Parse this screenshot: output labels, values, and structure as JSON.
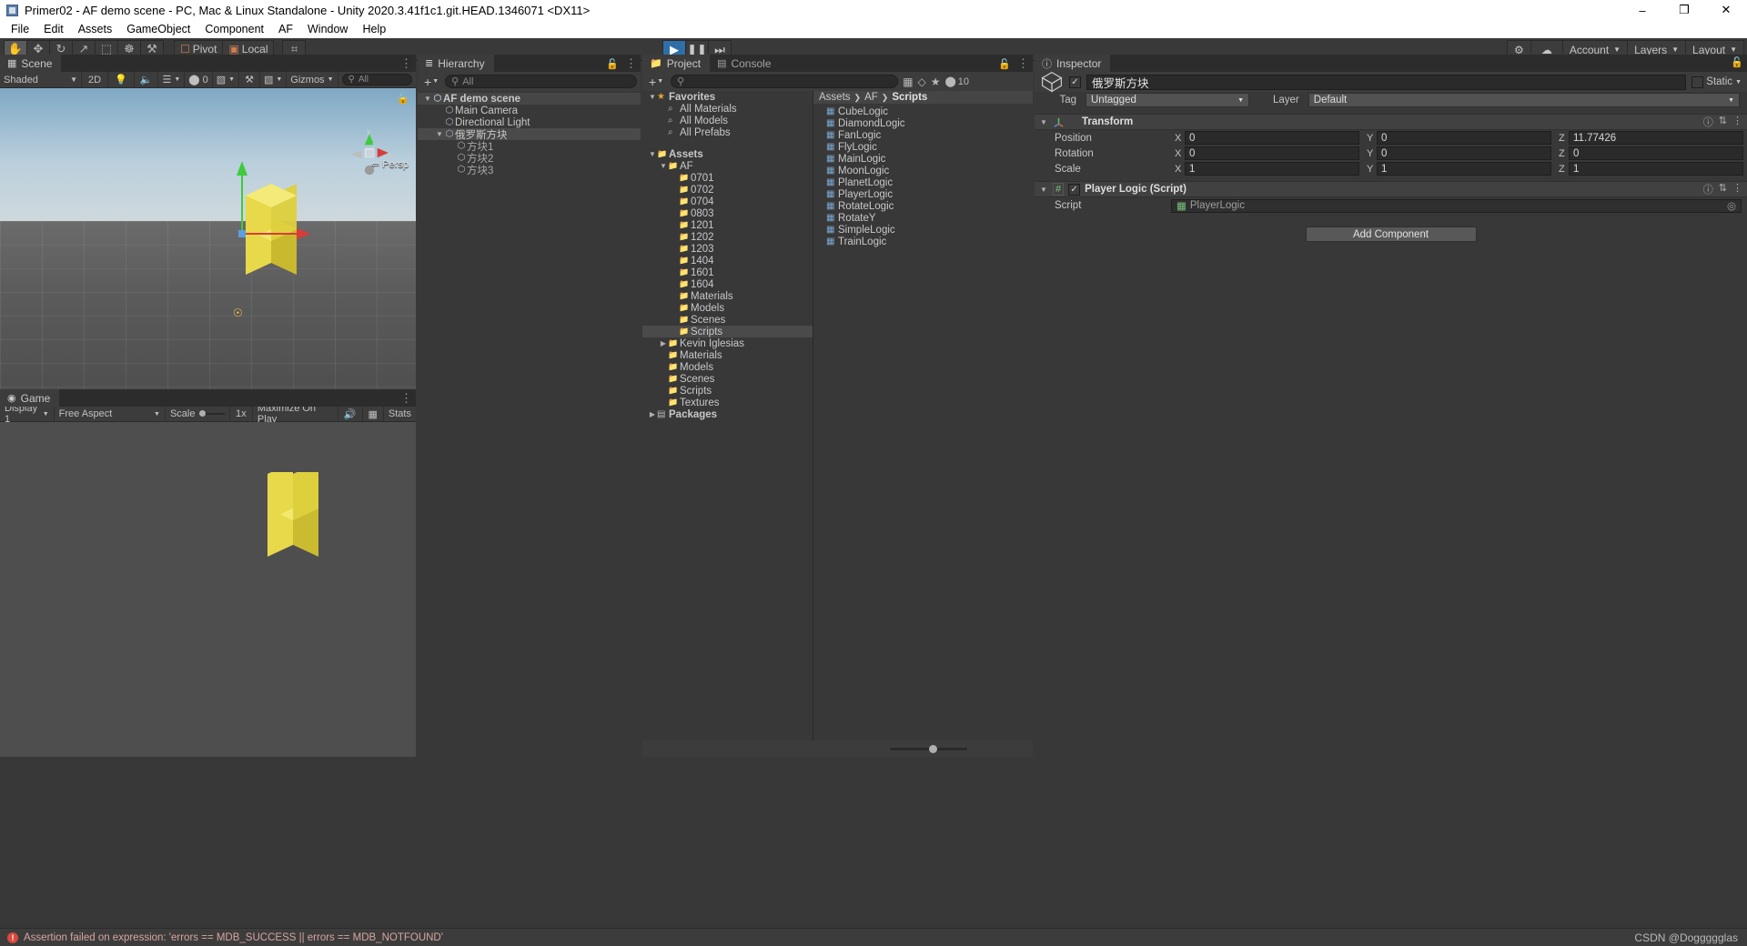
{
  "window": {
    "title": "Primer02 - AF demo scene - PC, Mac & Linux Standalone - Unity 2020.3.41f1c1.git.HEAD.1346071 <DX11>",
    "minimize": "–",
    "maximize": "❐",
    "close": "✕"
  },
  "menu": [
    "File",
    "Edit",
    "Assets",
    "GameObject",
    "Component",
    "AF",
    "Window",
    "Help"
  ],
  "toolbar": {
    "tools": [
      {
        "name": "hand-tool",
        "glyph": "✋",
        "active": true
      },
      {
        "name": "move-tool",
        "glyph": "✥",
        "active": false
      },
      {
        "name": "rotate-tool",
        "glyph": "↻",
        "active": false
      },
      {
        "name": "scale-tool",
        "glyph": "↗",
        "active": false
      },
      {
        "name": "rect-tool",
        "glyph": "⬚",
        "active": false
      },
      {
        "name": "transform-tool",
        "glyph": "☸",
        "active": false
      },
      {
        "name": "custom-tool",
        "glyph": "⚒",
        "active": false
      }
    ],
    "pivot_label": "Pivot",
    "local_label": "Local",
    "snap_glyph": "⌗",
    "play": "▶",
    "pause": "❚❚",
    "step": "⏭",
    "cloud_glyph": "☁",
    "collab_glyph": "⇄",
    "account_label": "Account",
    "layers_label": "Layers",
    "layout_label": "Layout"
  },
  "scene": {
    "tab_label": "Scene",
    "tab_icon": "grid-icon",
    "shading": "Shaded",
    "mode_2d": "2D",
    "lighting_icon": "lightbulb-icon",
    "audio_icon": "speaker-icon",
    "fx_icon": "effects-icon",
    "hidden_count": "0",
    "grid_icon": "grid-visibility-icon",
    "tools_icon": "scene-tools-icon",
    "camera_icon": "scene-camera-icon",
    "gizmos_label": "Gizmos",
    "search_placeholder": "All",
    "perspective_label": "Persp",
    "axis_x": "x",
    "axis_y": "y",
    "axis_z": "z"
  },
  "game": {
    "tab_label": "Game",
    "tab_icon": "gamepad-icon",
    "display": "Display 1",
    "aspect": "Free Aspect",
    "scale_label": "Scale",
    "scale_value": "1x",
    "maximize_label": "Maximize On Play",
    "mute_icon": "mute-audio-icon",
    "stats_label": "Stats",
    "gizmos_icon": "game-gizmos-icon"
  },
  "hierarchy": {
    "tab_label": "Hierarchy",
    "tab_icon": "hierarchy-icon",
    "lock_icon": "lock-icon",
    "menu_icon": "kebab-icon",
    "add_label": "+",
    "search_placeholder": "All",
    "items": [
      {
        "label": "AF demo scene",
        "depth": 0,
        "icon": "scene-icon",
        "expanded": true,
        "selected": false,
        "is_scene": true
      },
      {
        "label": "Main Camera",
        "depth": 1,
        "icon": "cube-icon",
        "expanded": null,
        "selected": false
      },
      {
        "label": "Directional Light",
        "depth": 1,
        "icon": "cube-icon",
        "expanded": null,
        "selected": false
      },
      {
        "label": "俄罗斯方块",
        "depth": 1,
        "icon": "cube-icon",
        "expanded": true,
        "selected": true
      },
      {
        "label": "方块1",
        "depth": 2,
        "icon": "cube-icon",
        "expanded": null,
        "selected": false
      },
      {
        "label": "方块2",
        "depth": 2,
        "icon": "cube-icon",
        "expanded": null,
        "selected": false
      },
      {
        "label": "方块3",
        "depth": 2,
        "icon": "cube-icon",
        "expanded": null,
        "selected": false
      }
    ]
  },
  "project": {
    "tab_label": "Project",
    "tab_icon": "folder-icon",
    "console_tab_label": "Console",
    "console_tab_icon": "console-icon",
    "lock_icon": "lock-icon",
    "menu_icon": "kebab-icon",
    "add_label": "+",
    "search_placeholder": "",
    "filter_icons": [
      "package-filter-icon",
      "label-filter-icon",
      "favorite-filter-icon"
    ],
    "hidden_count": "10",
    "breadcrumb": [
      "Assets",
      "AF",
      "Scripts"
    ],
    "tree": [
      {
        "label": "Favorites",
        "depth": 0,
        "icon": "star-icon",
        "expanded": true
      },
      {
        "label": "All Materials",
        "depth": 1,
        "icon": "search-icon"
      },
      {
        "label": "All Models",
        "depth": 1,
        "icon": "search-icon"
      },
      {
        "label": "All Prefabs",
        "depth": 1,
        "icon": "search-icon"
      },
      {
        "label": "",
        "depth": 0,
        "icon": "spacer"
      },
      {
        "label": "Assets",
        "depth": 0,
        "icon": "assets-folder-icon",
        "expanded": true
      },
      {
        "label": "AF",
        "depth": 1,
        "icon": "folder-icon",
        "expanded": true
      },
      {
        "label": "0701",
        "depth": 2,
        "icon": "folder-icon"
      },
      {
        "label": "0702",
        "depth": 2,
        "icon": "folder-icon"
      },
      {
        "label": "0704",
        "depth": 2,
        "icon": "folder-icon"
      },
      {
        "label": "0803",
        "depth": 2,
        "icon": "folder-icon"
      },
      {
        "label": "1201",
        "depth": 2,
        "icon": "folder-icon"
      },
      {
        "label": "1202",
        "depth": 2,
        "icon": "folder-icon"
      },
      {
        "label": "1203",
        "depth": 2,
        "icon": "folder-icon"
      },
      {
        "label": "1404",
        "depth": 2,
        "icon": "folder-icon"
      },
      {
        "label": "1601",
        "depth": 2,
        "icon": "folder-icon"
      },
      {
        "label": "1604",
        "depth": 2,
        "icon": "folder-icon"
      },
      {
        "label": "Materials",
        "depth": 2,
        "icon": "folder-icon"
      },
      {
        "label": "Models",
        "depth": 2,
        "icon": "folder-icon"
      },
      {
        "label": "Scenes",
        "depth": 2,
        "icon": "folder-icon"
      },
      {
        "label": "Scripts",
        "depth": 2,
        "icon": "folder-icon",
        "selected": true
      },
      {
        "label": "Kevin Iglesias",
        "depth": 1,
        "icon": "folder-icon",
        "collapsed": true
      },
      {
        "label": "Materials",
        "depth": 1,
        "icon": "folder-icon"
      },
      {
        "label": "Models",
        "depth": 1,
        "icon": "folder-icon"
      },
      {
        "label": "Scenes",
        "depth": 1,
        "icon": "folder-icon"
      },
      {
        "label": "Scripts",
        "depth": 1,
        "icon": "folder-icon"
      },
      {
        "label": "Textures",
        "depth": 1,
        "icon": "folder-icon"
      },
      {
        "label": "Packages",
        "depth": 0,
        "icon": "package-icon",
        "collapsed": true
      }
    ],
    "assets": [
      {
        "label": "CubeLogic",
        "icon": "cs-script-icon"
      },
      {
        "label": "DiamondLogic",
        "icon": "cs-script-icon"
      },
      {
        "label": "FanLogic",
        "icon": "cs-script-icon"
      },
      {
        "label": "FlyLogic",
        "icon": "cs-script-icon"
      },
      {
        "label": "MainLogic",
        "icon": "cs-script-icon"
      },
      {
        "label": "MoonLogic",
        "icon": "cs-script-icon"
      },
      {
        "label": "PlanetLogic",
        "icon": "cs-script-icon"
      },
      {
        "label": "PlayerLogic",
        "icon": "cs-script-icon"
      },
      {
        "label": "RotateLogic",
        "icon": "cs-script-icon"
      },
      {
        "label": "RotateY",
        "icon": "cs-script-icon"
      },
      {
        "label": "SimpleLogic",
        "icon": "cs-script-icon"
      },
      {
        "label": "TrainLogic",
        "icon": "cs-script-icon"
      }
    ]
  },
  "inspector": {
    "tab_label": "Inspector",
    "tab_icon": "info-icon",
    "lock_icon": "lock-icon",
    "object_name": "俄罗斯方块",
    "enabled": true,
    "static_label": "Static",
    "tag_label": "Tag",
    "tag_value": "Untagged",
    "layer_label": "Layer",
    "layer_value": "Default",
    "transform": {
      "title": "Transform",
      "icon": "transform-icon",
      "rows": [
        {
          "label": "Position",
          "x": "0",
          "y": "0",
          "z": "11.77426"
        },
        {
          "label": "Rotation",
          "x": "0",
          "y": "0",
          "z": "0"
        },
        {
          "label": "Scale",
          "x": "1",
          "y": "1",
          "z": "1"
        }
      ],
      "axes": [
        "X",
        "Y",
        "Z"
      ]
    },
    "component": {
      "title": "Player Logic (Script)",
      "icon": "cs-script-icon",
      "enabled": true,
      "script_label": "Script",
      "script_value": "PlayerLogic"
    },
    "add_component_label": "Add Component"
  },
  "status": {
    "message": "Assertion failed on expression: 'errors == MDB_SUCCESS || errors == MDB_NOTFOUND'",
    "icon": "error-icon",
    "watermark": "CSDN @Doggggglas"
  },
  "colors": {
    "accent_blue": "#2f6fa8",
    "panel_bg": "#383838",
    "toolbar_bg": "#393939",
    "error_red": "#d84a3c",
    "selection": "#4a4a4a",
    "cube_yellow": "#e8d94a",
    "folder_yellow": "#c8a95a",
    "star_gold": "#e0a82e"
  }
}
